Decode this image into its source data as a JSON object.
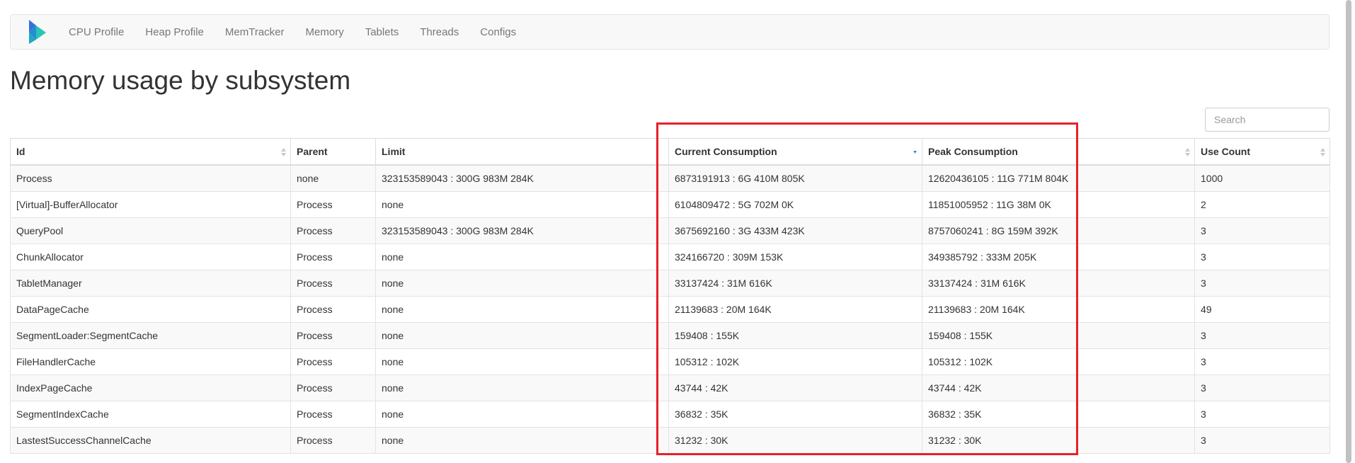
{
  "nav": {
    "items": [
      "CPU Profile",
      "Heap Profile",
      "MemTracker",
      "Memory",
      "Tablets",
      "Threads",
      "Configs"
    ]
  },
  "page_title": "Memory usage by subsystem",
  "search": {
    "placeholder": "Search"
  },
  "table": {
    "columns": [
      "Id",
      "Parent",
      "Limit",
      "Current Consumption",
      "Peak Consumption",
      "Use Count"
    ],
    "sorted_column": "Current Consumption",
    "rows": [
      [
        "Process",
        "none",
        "323153589043 : 300G 983M 284K",
        "6873191913 : 6G 410M 805K",
        "12620436105 : 11G 771M 804K",
        "1000"
      ],
      [
        "[Virtual]-BufferAllocator",
        "Process",
        "none",
        "6104809472 : 5G 702M 0K",
        "11851005952 : 11G 38M 0K",
        "2"
      ],
      [
        "QueryPool",
        "Process",
        "323153589043 : 300G 983M 284K",
        "3675692160 : 3G 433M 423K",
        "8757060241 : 8G 159M 392K",
        "3"
      ],
      [
        "ChunkAllocator",
        "Process",
        "none",
        "324166720 : 309M 153K",
        "349385792 : 333M 205K",
        "3"
      ],
      [
        "TabletManager",
        "Process",
        "none",
        "33137424 : 31M 616K",
        "33137424 : 31M 616K",
        "3"
      ],
      [
        "DataPageCache",
        "Process",
        "none",
        "21139683 : 20M 164K",
        "21139683 : 20M 164K",
        "49"
      ],
      [
        "SegmentLoader:SegmentCache",
        "Process",
        "none",
        "159408 : 155K",
        "159408 : 155K",
        "3"
      ],
      [
        "FileHandlerCache",
        "Process",
        "none",
        "105312 : 102K",
        "105312 : 102K",
        "3"
      ],
      [
        "IndexPageCache",
        "Process",
        "none",
        "43744 : 42K",
        "43744 : 42K",
        "3"
      ],
      [
        "SegmentIndexCache",
        "Process",
        "none",
        "36832 : 35K",
        "36832 : 35K",
        "3"
      ],
      [
        "LastestSuccessChannelCache",
        "Process",
        "none",
        "31232 : 30K",
        "31232 : 30K",
        "3"
      ]
    ]
  },
  "colors": {
    "highlight": "#e8202a",
    "sort_active": "#4a7ec9",
    "sort_inactive": "#c9c9c9",
    "logo_blue": "#3a6fd8",
    "logo_teal": "#2bc4b4"
  }
}
